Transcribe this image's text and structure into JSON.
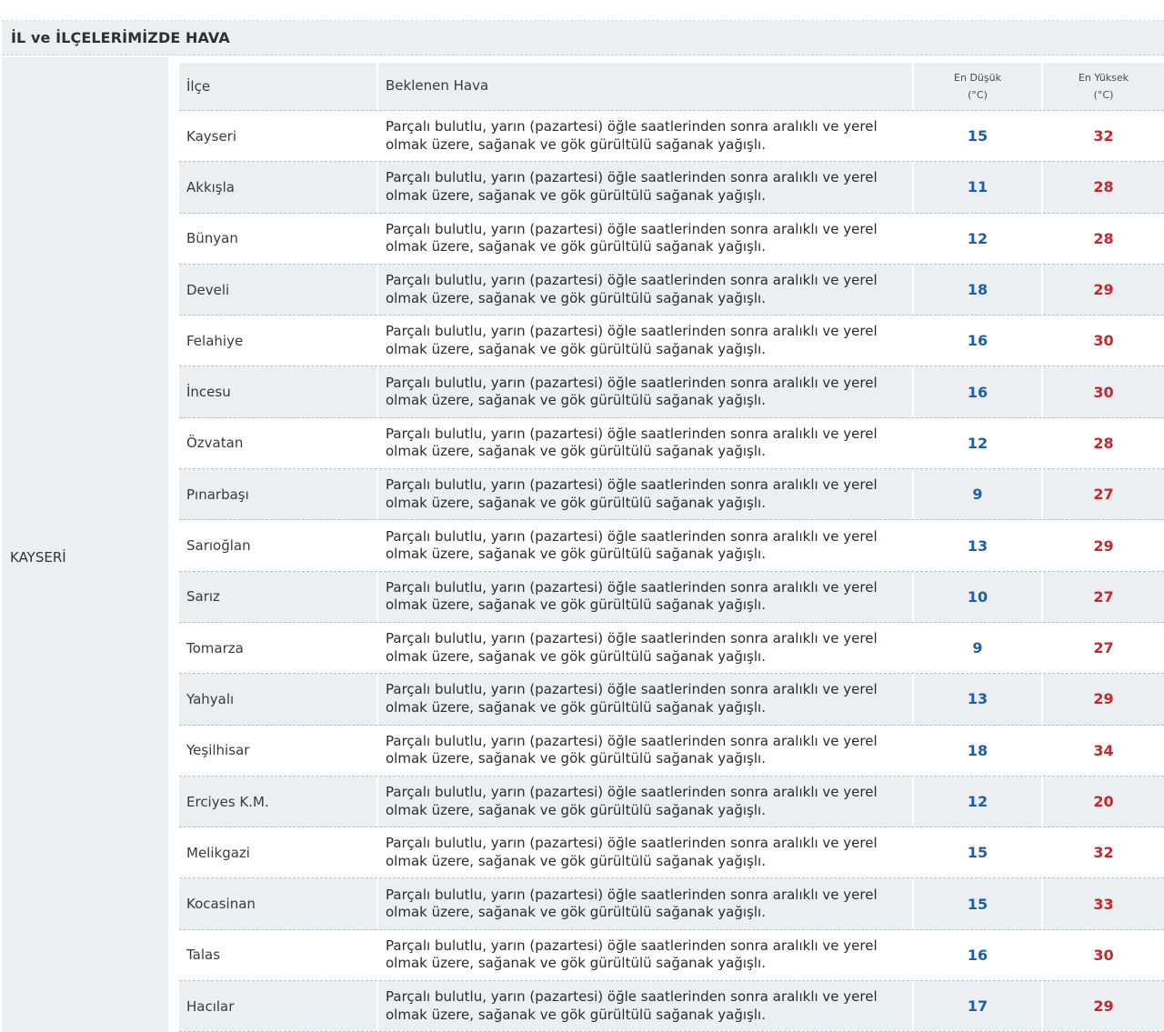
{
  "section_title": "İL ve İLÇELERİMİZDE HAVA",
  "province": "KAYSERİ",
  "columns": {
    "ilce": "İlçe",
    "hava": "Beklenen Hava",
    "min_line1": "En Düşük",
    "min_line2": "(°C)",
    "max_line1": "En Yüksek",
    "max_line2": "(°C)"
  },
  "colors": {
    "min_value": "#1f5fa3",
    "max_value": "#c8262a",
    "stripe": "#ebeff2"
  },
  "rows": [
    {
      "ilce": "Kayseri",
      "hava": "Parçalı bulutlu, yarın (pazartesi) öğle saatlerinden sonra aralıklı ve yerel olmak üzere, sağanak ve gök gürültülü sağanak yağışlı.",
      "min": "15",
      "max": "32"
    },
    {
      "ilce": "Akkışla",
      "hava": "Parçalı bulutlu, yarın (pazartesi) öğle saatlerinden sonra aralıklı ve yerel olmak üzere, sağanak ve gök gürültülü sağanak yağışlı.",
      "min": "11",
      "max": "28"
    },
    {
      "ilce": "Bünyan",
      "hava": "Parçalı bulutlu, yarın (pazartesi) öğle saatlerinden sonra aralıklı ve yerel olmak üzere, sağanak ve gök gürültülü sağanak yağışlı.",
      "min": "12",
      "max": "28"
    },
    {
      "ilce": "Develi",
      "hava": "Parçalı bulutlu, yarın (pazartesi) öğle saatlerinden sonra aralıklı ve yerel olmak üzere, sağanak ve gök gürültülü sağanak yağışlı.",
      "min": "18",
      "max": "29"
    },
    {
      "ilce": "Felahiye",
      "hava": "Parçalı bulutlu, yarın (pazartesi) öğle saatlerinden sonra aralıklı ve yerel olmak üzere, sağanak ve gök gürültülü sağanak yağışlı.",
      "min": "16",
      "max": "30"
    },
    {
      "ilce": "İncesu",
      "hava": "Parçalı bulutlu, yarın (pazartesi) öğle saatlerinden sonra aralıklı ve yerel olmak üzere, sağanak ve gök gürültülü sağanak yağışlı.",
      "min": "16",
      "max": "30"
    },
    {
      "ilce": "Özvatan",
      "hava": "Parçalı bulutlu, yarın (pazartesi) öğle saatlerinden sonra aralıklı ve yerel olmak üzere, sağanak ve gök gürültülü sağanak yağışlı.",
      "min": "12",
      "max": "28"
    },
    {
      "ilce": "Pınarbaşı",
      "hava": "Parçalı bulutlu, yarın (pazartesi) öğle saatlerinden sonra aralıklı ve yerel olmak üzere, sağanak ve gök gürültülü sağanak yağışlı.",
      "min": "9",
      "max": "27"
    },
    {
      "ilce": "Sarıoğlan",
      "hava": "Parçalı bulutlu, yarın (pazartesi) öğle saatlerinden sonra aralıklı ve yerel olmak üzere, sağanak ve gök gürültülü sağanak yağışlı.",
      "min": "13",
      "max": "29"
    },
    {
      "ilce": "Sarız",
      "hava": "Parçalı bulutlu, yarın (pazartesi) öğle saatlerinden sonra aralıklı ve yerel olmak üzere, sağanak ve gök gürültülü sağanak yağışlı.",
      "min": "10",
      "max": "27"
    },
    {
      "ilce": "Tomarza",
      "hava": "Parçalı bulutlu, yarın (pazartesi) öğle saatlerinden sonra aralıklı ve yerel olmak üzere, sağanak ve gök gürültülü sağanak yağışlı.",
      "min": "9",
      "max": "27"
    },
    {
      "ilce": "Yahyalı",
      "hava": "Parçalı bulutlu, yarın (pazartesi) öğle saatlerinden sonra aralıklı ve yerel olmak üzere, sağanak ve gök gürültülü sağanak yağışlı.",
      "min": "13",
      "max": "29"
    },
    {
      "ilce": "Yeşilhisar",
      "hava": "Parçalı bulutlu, yarın (pazartesi) öğle saatlerinden sonra aralıklı ve yerel olmak üzere, sağanak ve gök gürültülü sağanak yağışlı.",
      "min": "18",
      "max": "34"
    },
    {
      "ilce": "Erciyes K.M.",
      "hava": "Parçalı bulutlu, yarın (pazartesi) öğle saatlerinden sonra aralıklı ve yerel olmak üzere, sağanak ve gök gürültülü sağanak yağışlı.",
      "min": "12",
      "max": "20"
    },
    {
      "ilce": "Melikgazi",
      "hava": "Parçalı bulutlu, yarın (pazartesi) öğle saatlerinden sonra aralıklı ve yerel olmak üzere, sağanak ve gök gürültülü sağanak yağışlı.",
      "min": "15",
      "max": "32"
    },
    {
      "ilce": "Kocasinan",
      "hava": "Parçalı bulutlu, yarın (pazartesi) öğle saatlerinden sonra aralıklı ve yerel olmak üzere, sağanak ve gök gürültülü sağanak yağışlı.",
      "min": "15",
      "max": "33"
    },
    {
      "ilce": "Talas",
      "hava": "Parçalı bulutlu, yarın (pazartesi) öğle saatlerinden sonra aralıklı ve yerel olmak üzere, sağanak ve gök gürültülü sağanak yağışlı.",
      "min": "16",
      "max": "30"
    },
    {
      "ilce": "Hacılar",
      "hava": "Parçalı bulutlu, yarın (pazartesi) öğle saatlerinden sonra aralıklı ve yerel olmak üzere, sağanak ve gök gürültülü sağanak yağışlı.",
      "min": "17",
      "max": "29"
    }
  ]
}
